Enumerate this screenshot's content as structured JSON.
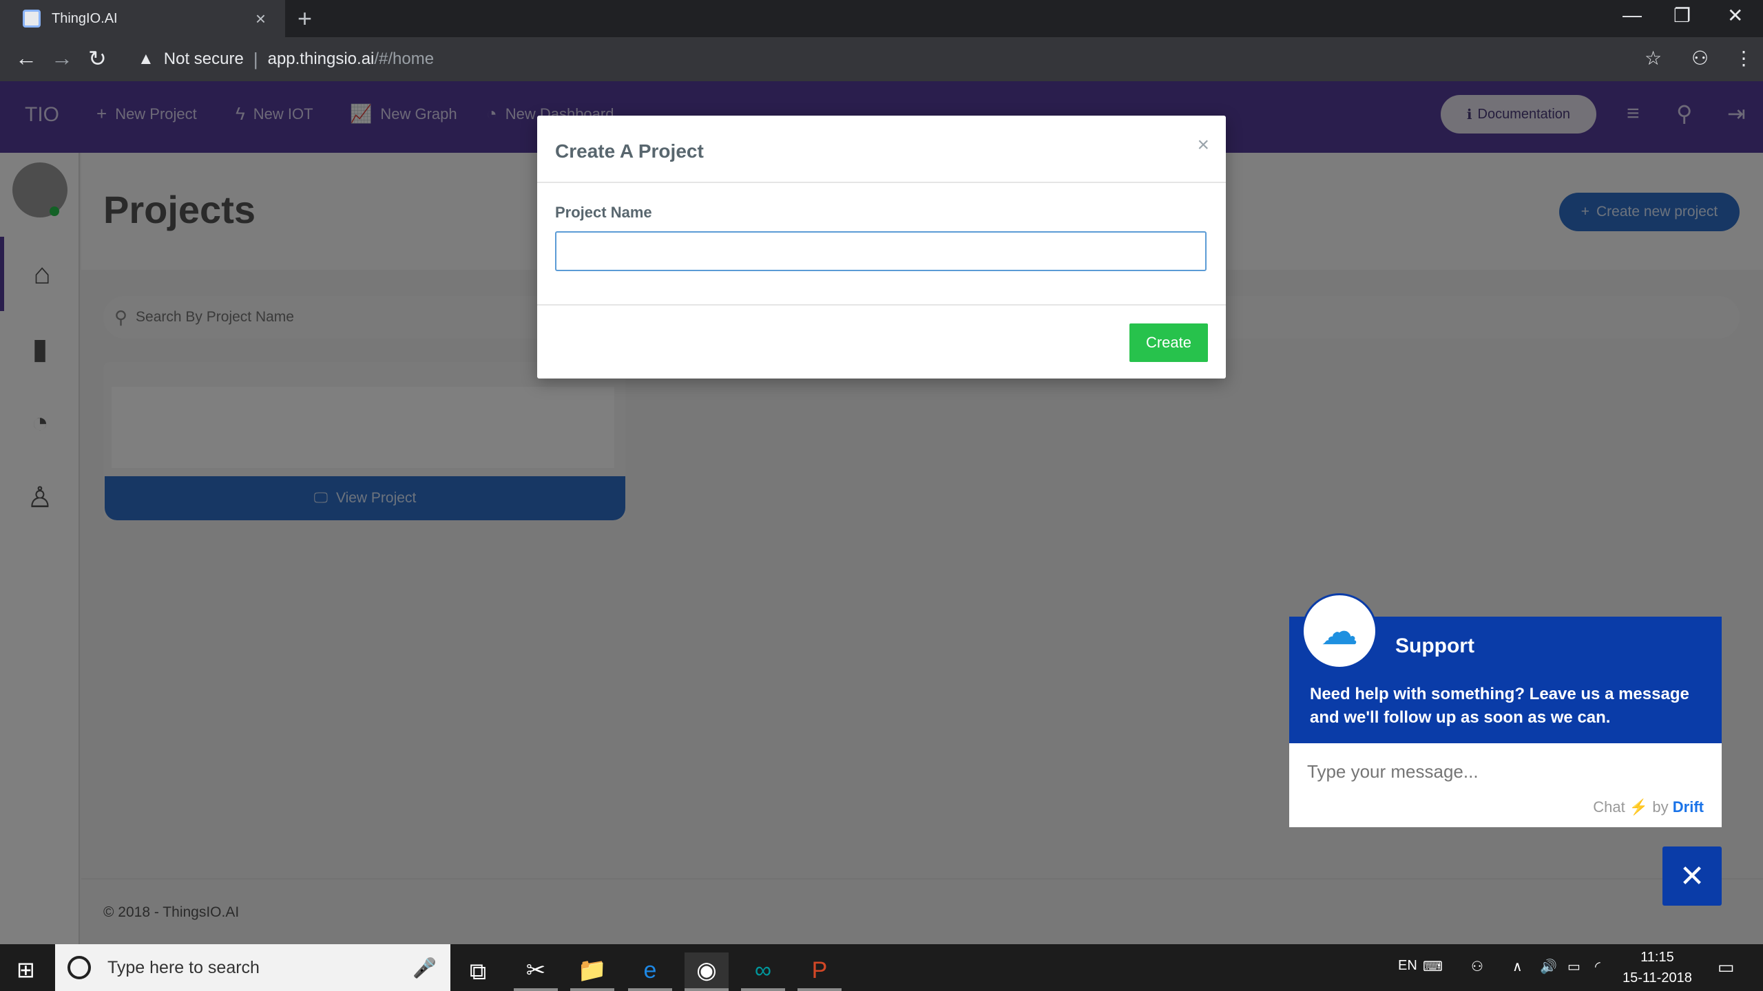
{
  "browser": {
    "tab_title": "ThingIO.AI",
    "tab_close": "×",
    "new_tab": "+",
    "not_secure": "Not secure",
    "url_host": "app.thingsio.ai",
    "url_path": "/#/home",
    "minimize": "—",
    "restore": "❐",
    "close": "✕"
  },
  "header": {
    "brand": "TIO",
    "nav": [
      {
        "icon": "+",
        "label": "New Project"
      },
      {
        "icon": "ϟ",
        "label": "New IOT"
      },
      {
        "icon": "📈",
        "label": "New Graph"
      },
      {
        "icon": "◔",
        "label": "New Dashboard"
      }
    ],
    "documentation": "Documentation"
  },
  "page": {
    "title": "Projects",
    "create_new": "Create new project",
    "search_placeholder": "Search By Project Name",
    "view_project": "View Project",
    "footer": "© 2018 - ThingsIO.AI"
  },
  "modal": {
    "title": "Create A Project",
    "close": "×",
    "field_label": "Project Name",
    "field_value": "",
    "create": "Create"
  },
  "drift": {
    "title": "Support",
    "message": "Need help with something? Leave us a message and we'll follow up as soon as we can.",
    "input_placeholder": "Type your message...",
    "credit_chat": "Chat",
    "credit_by": "by",
    "credit_brand": "Drift",
    "close": "✕"
  },
  "taskbar": {
    "search_placeholder": "Type here to search",
    "lang": "EN",
    "time": "11:15",
    "date": "15-11-2018"
  },
  "colors": {
    "header": "#553d9a",
    "primary": "#2f6fc9",
    "success": "#27c24c",
    "drift": "#0a3ca8"
  }
}
